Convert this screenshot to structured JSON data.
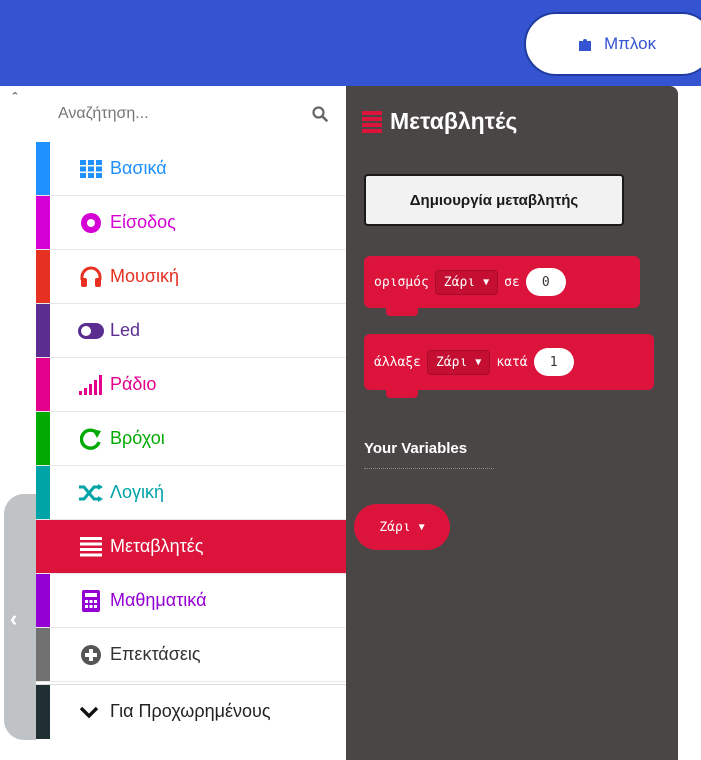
{
  "header": {
    "blocks_label": "Μπλοκ",
    "bar_color": "#3454d1"
  },
  "toolbox": {
    "search_placeholder": "Αναζήτηση...",
    "categories": [
      {
        "label": "Βασικά",
        "color": "#1e90ff",
        "icon": "grid-icon"
      },
      {
        "label": "Είσοδος",
        "color": "#d400d4",
        "icon": "circle-dot-icon"
      },
      {
        "label": "Μουσική",
        "color": "#e63022",
        "icon": "headphones-icon"
      },
      {
        "label": "Led",
        "color": "#5c2d91",
        "icon": "toggle-icon"
      },
      {
        "label": "Ράδιο",
        "color": "#e3008c",
        "icon": "signal-bars-icon"
      },
      {
        "label": "Βρόχοι",
        "color": "#00aa00",
        "icon": "loop-arrow-icon"
      },
      {
        "label": "Λογική",
        "color": "#00a4a6",
        "icon": "shuffle-icon"
      },
      {
        "label": "Μεταβλητές",
        "color": "#dc143c",
        "icon": "lines-icon",
        "selected": true
      },
      {
        "label": "Μαθηματικά",
        "color": "#9400d3",
        "icon": "calculator-icon"
      },
      {
        "label": "Επεκτάσεις",
        "color": "#717171",
        "icon": "plus-circle-icon"
      }
    ],
    "advanced_label": "Για Προχωρημένους"
  },
  "flyout": {
    "title": "Μεταβλητές",
    "make_variable_label": "Δημιουργία μεταβλητής",
    "set_block": {
      "keyword": "ορισμός",
      "variable": "Ζάρι",
      "to": "σε",
      "value": "0"
    },
    "change_block": {
      "keyword": "άλλαξε",
      "variable": "Ζάρι",
      "by": "κατά",
      "value": "1"
    },
    "your_variables_label": "Your Variables",
    "variable_pill": "Ζάρι",
    "block_color": "#dc143c",
    "background": "#4a4646"
  }
}
